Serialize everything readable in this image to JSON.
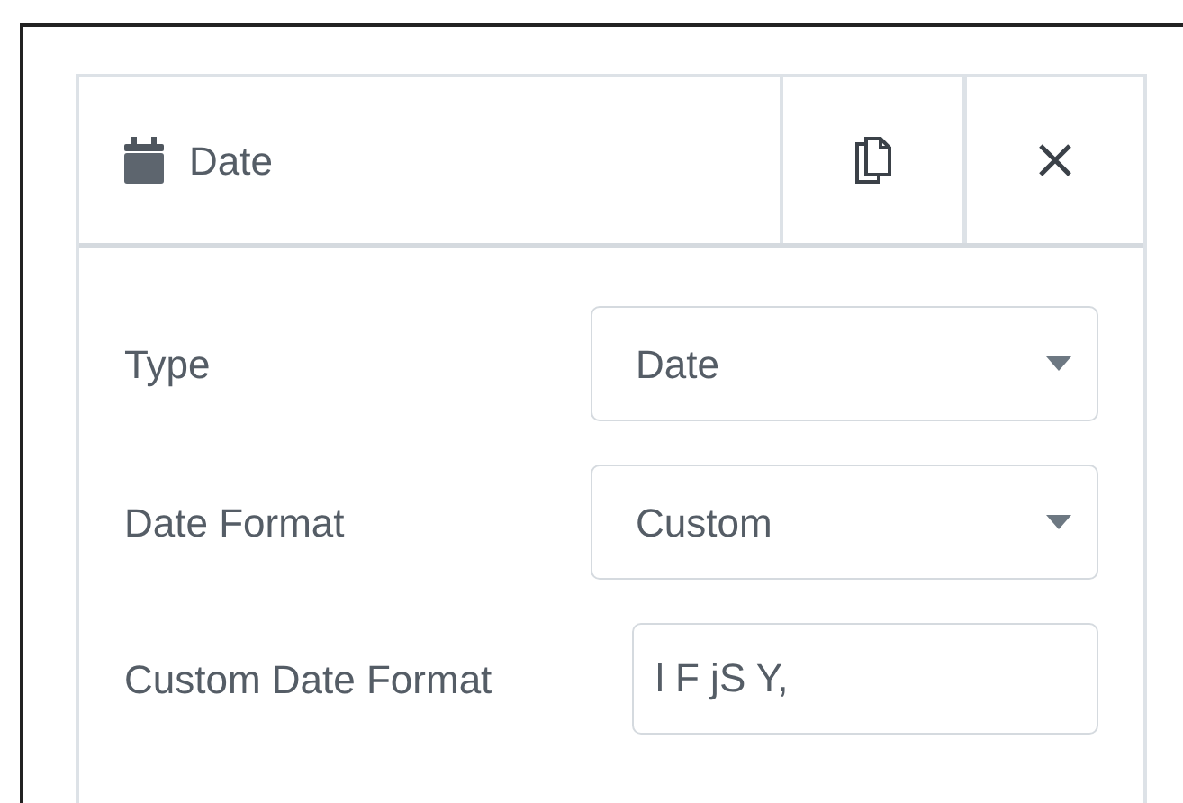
{
  "panel": {
    "title": "Date"
  },
  "fields": [
    {
      "kind": "select",
      "label": "Type",
      "value": "Date"
    },
    {
      "kind": "select",
      "label": "Date Format",
      "value": "Custom"
    },
    {
      "kind": "text",
      "label": "Custom Date Format",
      "value": "l F jS Y,"
    }
  ]
}
